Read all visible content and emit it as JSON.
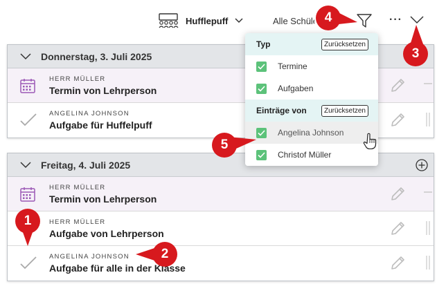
{
  "toolbar": {
    "class_label": "Hufflepuff",
    "student_label": "Alle Schüler",
    "more_label": "···"
  },
  "days": [
    {
      "title": "Donnerstag, 3. Juli 2025",
      "entries": [
        {
          "type": "event",
          "author": "HERR MÜLLER",
          "title": "Termin von Lehrperson"
        },
        {
          "type": "task",
          "author": "ANGELINA JOHNSON",
          "title": "Aufgabe für Huffelpuff"
        }
      ]
    },
    {
      "title": "Freitag, 4. Juli 2025",
      "entries": [
        {
          "type": "event",
          "author": "HERR MÜLLER",
          "title": "Termin von Lehrperson"
        },
        {
          "type": "task",
          "author": "HERR MÜLLER",
          "title": "Aufgabe von Lehrperson"
        },
        {
          "type": "task",
          "author": "ANGELINA JOHNSON",
          "title": "Aufgabe für alle in der Klasse"
        }
      ]
    }
  ],
  "filter_dropdown": {
    "type_section": {
      "title": "Typ",
      "reset_label": "Zurücksetzen",
      "items": [
        {
          "label": "Termine",
          "checked": true
        },
        {
          "label": "Aufgaben",
          "checked": true
        }
      ]
    },
    "author_section": {
      "title": "Einträge von",
      "reset_label": "Zurücksetzen",
      "items": [
        {
          "label": "Angelina Johnson",
          "checked": true
        },
        {
          "label": "Christof Müller",
          "checked": true
        }
      ]
    }
  },
  "callouts": [
    "1",
    "2",
    "3",
    "4",
    "5"
  ],
  "colors": {
    "accent_red": "#d7191e",
    "checkbox_green": "#5cc27a",
    "event_bg": "#f6f1f8",
    "event_icon": "#9b59b6",
    "section_bg": "#e4f4f4",
    "header_bg": "#e3e5e8"
  }
}
